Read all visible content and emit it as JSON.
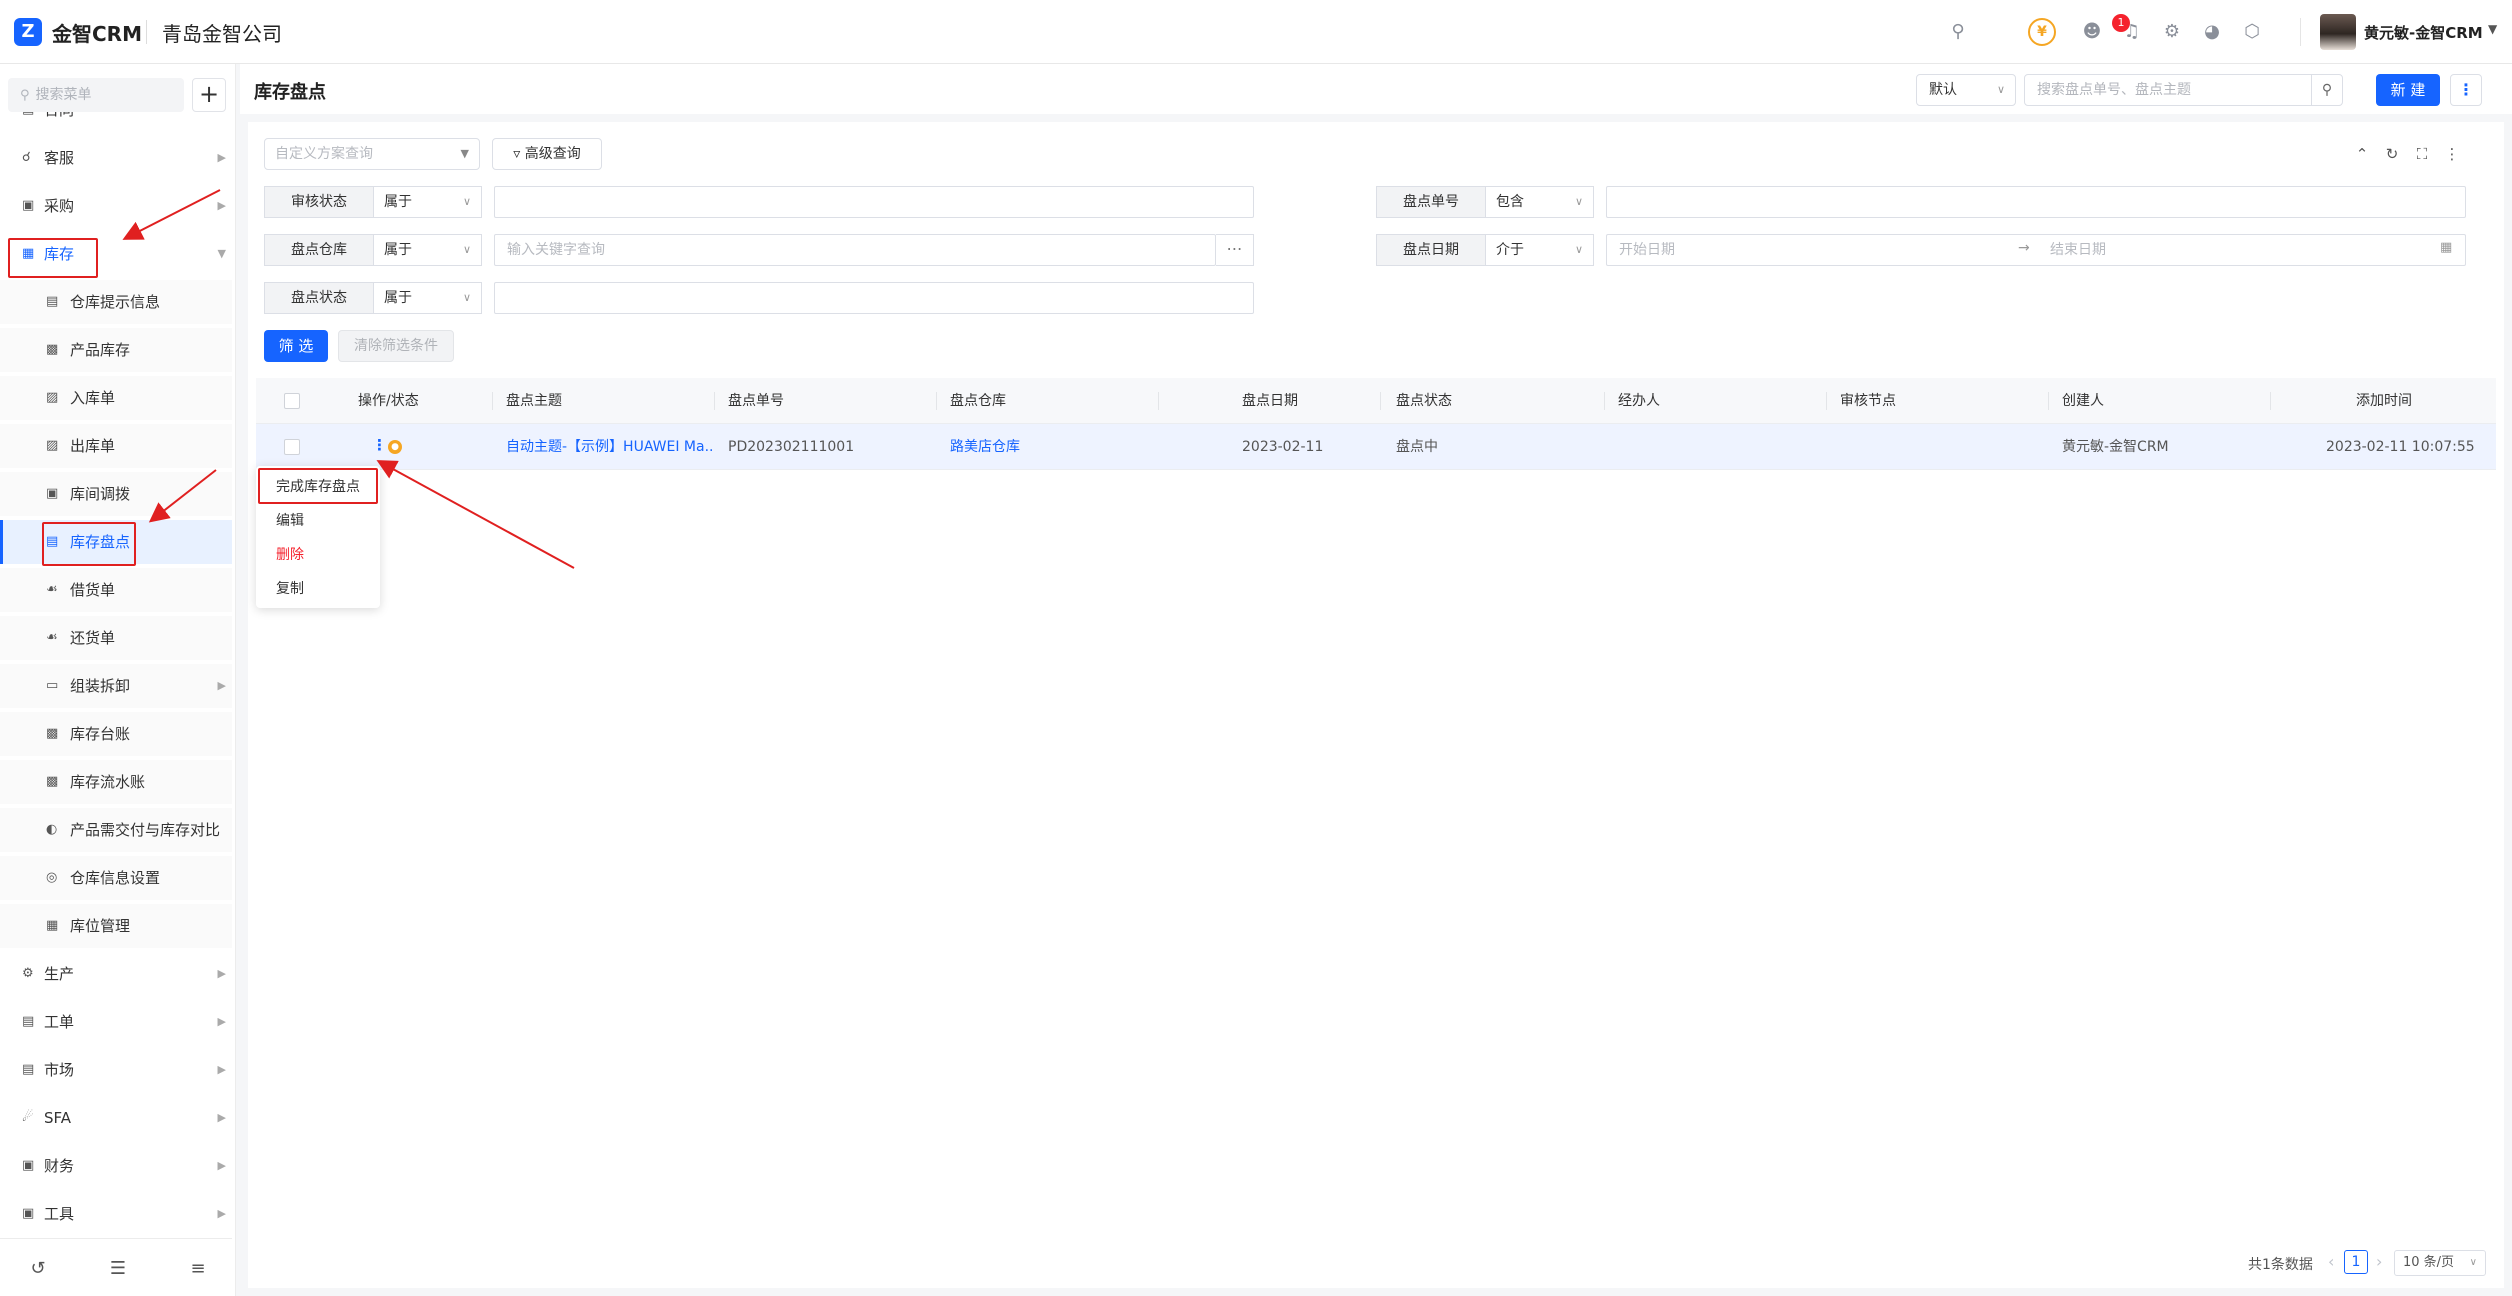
{
  "app": {
    "logo_char": "Z",
    "brand": "金智CRM",
    "company": "青岛金智公司",
    "badge_count": "1",
    "username": "黄元敏-金智CRM"
  },
  "sidebar": {
    "search_placeholder": "搜索菜单",
    "add_label": "+",
    "items": [
      {
        "label": "合同",
        "icon": "contract-icon"
      },
      {
        "label": "客服",
        "icon": "headset-icon"
      },
      {
        "label": "采购",
        "icon": "cart-icon"
      },
      {
        "label": "库存",
        "icon": "warehouse-icon"
      },
      {
        "label": "仓库提示信息",
        "icon": "info-icon"
      },
      {
        "label": "产品库存",
        "icon": "file-icon"
      },
      {
        "label": "入库单",
        "icon": "in-stock-icon"
      },
      {
        "label": "出库单",
        "icon": "out-stock-icon"
      },
      {
        "label": "库间调拨",
        "icon": "transfer-icon"
      },
      {
        "label": "库存盘点",
        "icon": "checklist-icon"
      },
      {
        "label": "借货单",
        "icon": "borrow-icon"
      },
      {
        "label": "还货单",
        "icon": "return-icon"
      },
      {
        "label": "组装拆卸",
        "icon": "folder-icon"
      },
      {
        "label": "库存台账",
        "icon": "ledger-icon"
      },
      {
        "label": "库存流水账",
        "icon": "ledger-icon"
      },
      {
        "label": "产品需交付与库存对比",
        "icon": "compare-icon"
      },
      {
        "label": "仓库信息设置",
        "icon": "settings-icon"
      },
      {
        "label": "库位管理",
        "icon": "grid-icon"
      },
      {
        "label": "生产",
        "icon": "production-icon"
      },
      {
        "label": "工单",
        "icon": "ticket-icon"
      },
      {
        "label": "市场",
        "icon": "market-icon"
      },
      {
        "label": "SFA",
        "icon": "sfa-icon"
      },
      {
        "label": "财务",
        "icon": "finance-icon"
      },
      {
        "label": "工具",
        "icon": "tools-icon"
      }
    ]
  },
  "header": {
    "title": "库存盘点",
    "view_select": "默认",
    "search_placeholder": "搜索盘点单号、盘点主题",
    "new_label": "新 建"
  },
  "filters": {
    "scheme_placeholder": "自定义方案查询",
    "advanced_label": "高级查询",
    "audit_status": {
      "label": "审核状态",
      "op": "属于"
    },
    "check_no": {
      "label": "盘点单号",
      "op": "包含"
    },
    "warehouse": {
      "label": "盘点仓库",
      "op": "属于",
      "placeholder": "输入关键字查询"
    },
    "check_date": {
      "label": "盘点日期",
      "op": "介于",
      "start_placeholder": "开始日期",
      "end_placeholder": "结束日期"
    },
    "check_status": {
      "label": "盘点状态",
      "op": "属于"
    },
    "filter_btn": "筛 选",
    "clear_btn": "清除筛选条件"
  },
  "table": {
    "headers": [
      "操作/状态",
      "盘点主题",
      "盘点单号",
      "盘点仓库",
      "盘点日期",
      "盘点状态",
      "经办人",
      "审核节点",
      "创建人",
      "添加时间"
    ],
    "rows": [
      {
        "subject": "自动主题-【示例】HUAWEI Ma...",
        "number": "PD202302111001",
        "warehouse": "路美店仓库",
        "date": "2023-02-11",
        "status": "盘点中",
        "handler": "",
        "audit_node": "",
        "creator": "黄元敏-金智CRM",
        "created_at": "2023-02-11 10:07:55"
      }
    ]
  },
  "row_menu": {
    "items": [
      "完成库存盘点",
      "编辑",
      "删除",
      "复制"
    ]
  },
  "pagination": {
    "total": "共1条数据",
    "page": "1",
    "page_size": "10 条/页"
  },
  "colors": {
    "primary": "#1664ff",
    "danger": "#f5222d",
    "annotation": "#e02020",
    "status_dot": "#f5a623"
  }
}
